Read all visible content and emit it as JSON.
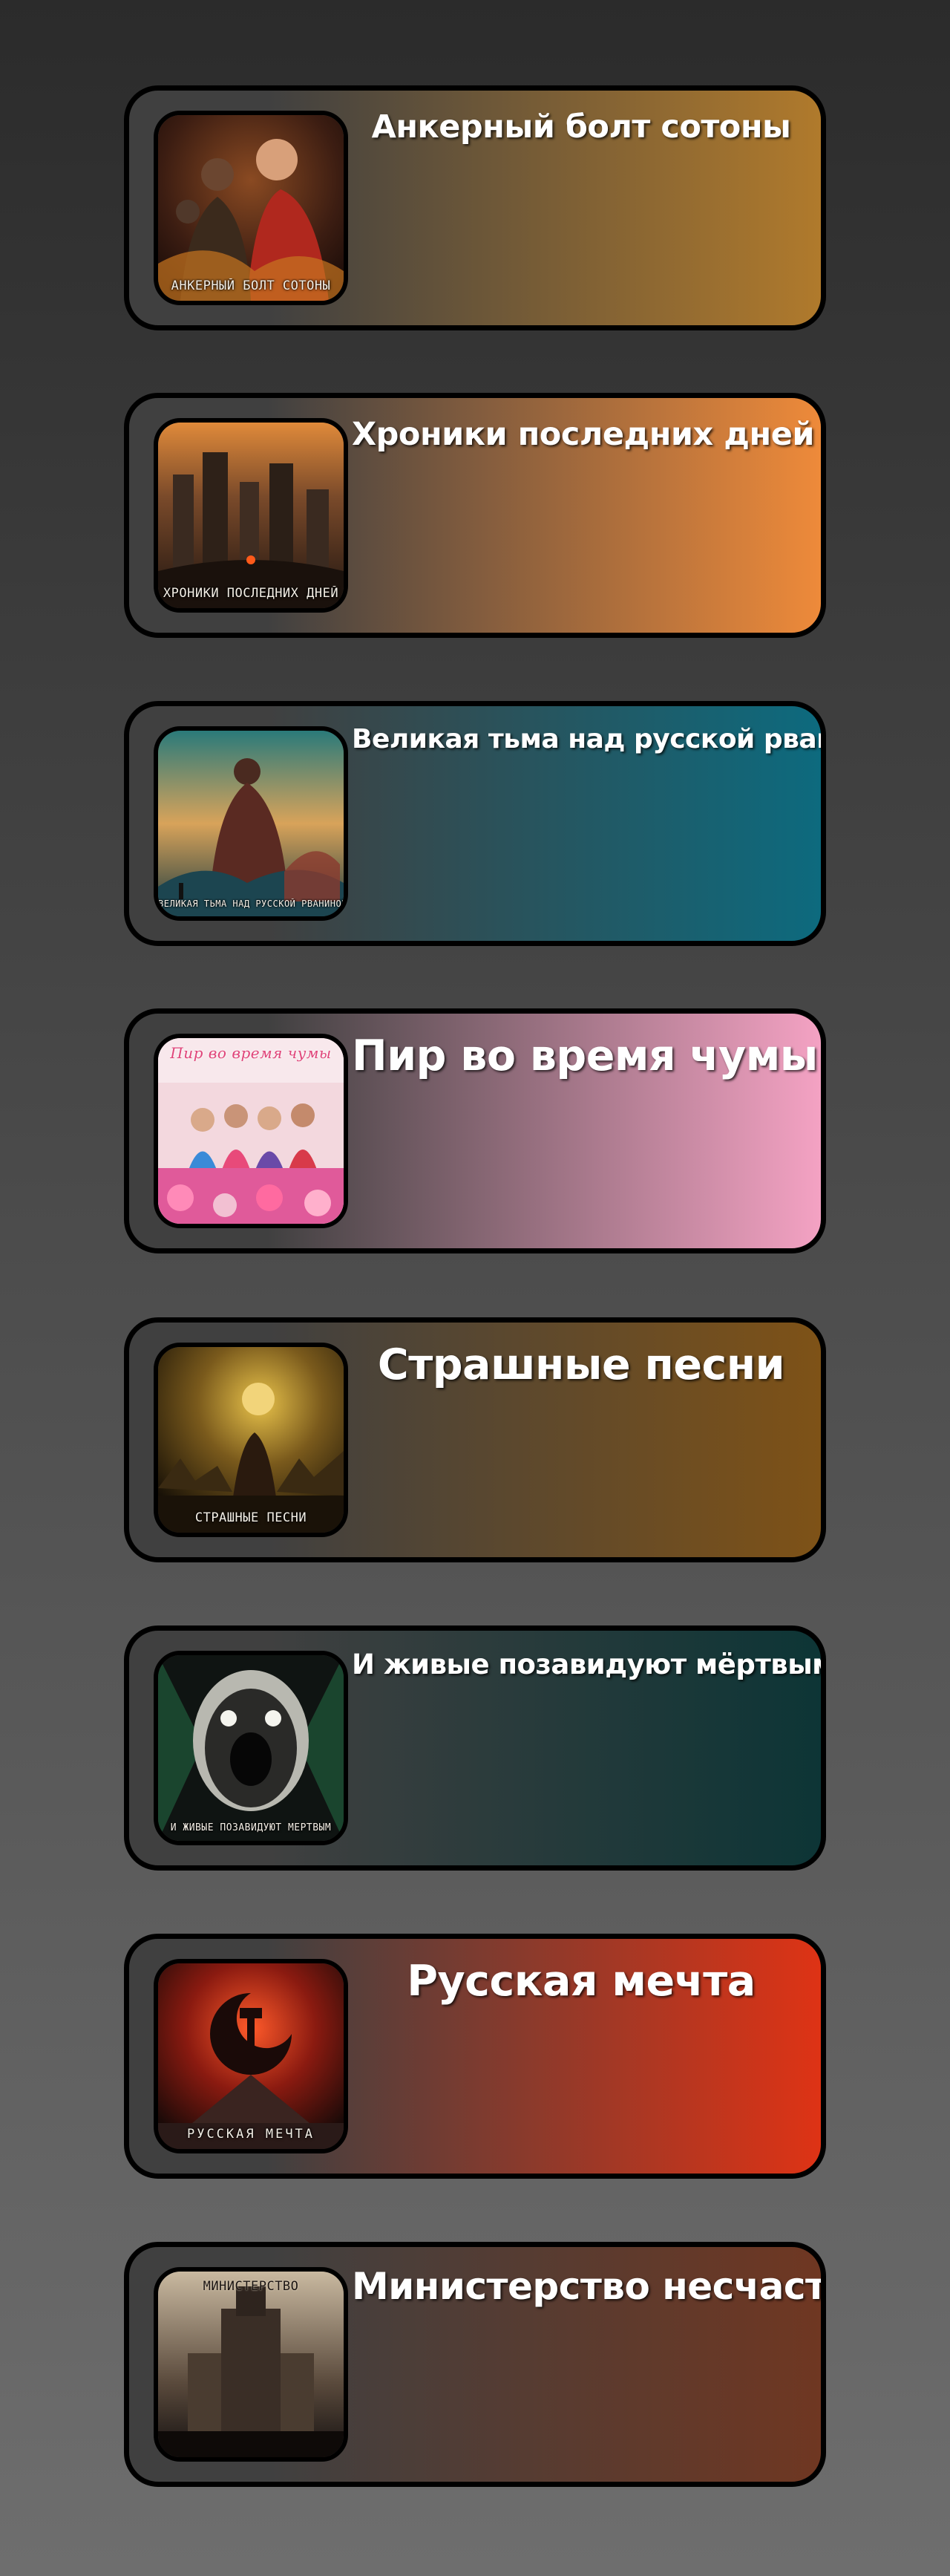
{
  "albums": [
    {
      "title": "Анкерный болт сотоны",
      "cover_caption": "Анкерный болт сотоны",
      "accent": "#b07a2c",
      "title_size": "43px"
    },
    {
      "title": "Хроники последних дней",
      "cover_caption": "Хроники последних дней",
      "accent": "#ee8a3a",
      "title_size": "43px"
    },
    {
      "title": "Великая тьма над русской рванiной",
      "cover_caption": "Великая тьма над русской рваниной",
      "accent": "#0d6a7e",
      "title_size": "36px"
    },
    {
      "title": "Пир во время чумы",
      "cover_caption": "Пир во время чумы",
      "accent": "#f4a2c3",
      "title_size": "57px"
    },
    {
      "title": "Страшные песни",
      "cover_caption": "Страшные песни",
      "accent": "#7e5217",
      "title_size": "57px"
    },
    {
      "title": "И живые позавидуют мёртвым",
      "cover_caption": "И живые позавидуют мёртвым",
      "accent": "#0d3536",
      "title_size": "37px"
    },
    {
      "title": "Русская мечта",
      "cover_caption": "Русская мечта",
      "accent": "#de3315",
      "title_size": "57px"
    },
    {
      "title": "Министерство несчастья",
      "cover_caption": "Министерство",
      "accent": "#6f3722",
      "title_size": "50px"
    }
  ]
}
